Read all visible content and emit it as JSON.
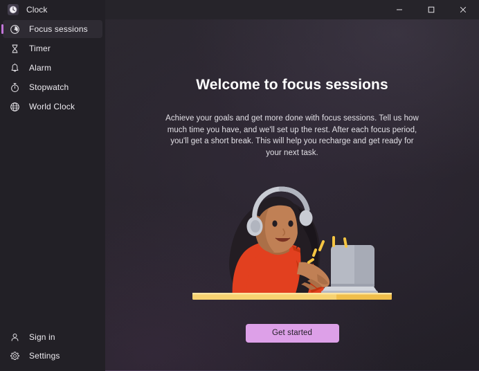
{
  "window": {
    "app_name": "Clock",
    "app_icon": "clock-app-icon",
    "controls": {
      "minimize": "minimize-icon",
      "maximize": "maximize-icon",
      "close": "close-icon"
    }
  },
  "sidebar": {
    "items": [
      {
        "label": "Focus sessions",
        "icon": "focus-sessions-icon",
        "selected": true
      },
      {
        "label": "Timer",
        "icon": "hourglass-icon",
        "selected": false
      },
      {
        "label": "Alarm",
        "icon": "bell-icon",
        "selected": false
      },
      {
        "label": "Stopwatch",
        "icon": "stopwatch-icon",
        "selected": false
      },
      {
        "label": "World Clock",
        "icon": "globe-icon",
        "selected": false
      }
    ],
    "bottom_items": [
      {
        "label": "Sign in",
        "icon": "person-icon"
      },
      {
        "label": "Settings",
        "icon": "gear-icon"
      }
    ]
  },
  "main": {
    "headline": "Welcome to focus sessions",
    "description": "Achieve your goals and get more done with focus sessions. Tell us how much time you have, and we'll set up the rest. After each focus period, you'll get a short break. This will help you recharge and get ready for your next task.",
    "cta_label": "Get started",
    "illustration_name": "person-at-laptop-illustration"
  },
  "colors": {
    "accent": "#c175d8",
    "cta_background": "#dda0e8",
    "sidebar_background": "#222026",
    "content_background": "#26242a",
    "selected_item_background": "#2e2b33",
    "illustration_shirt": "#e2401f",
    "illustration_hair": "#231d23",
    "illustration_skin": "#c08055",
    "illustration_desk": "#f7d271",
    "illustration_laptop": "#b6bac4",
    "illustration_sparkle": "#f5c542"
  }
}
